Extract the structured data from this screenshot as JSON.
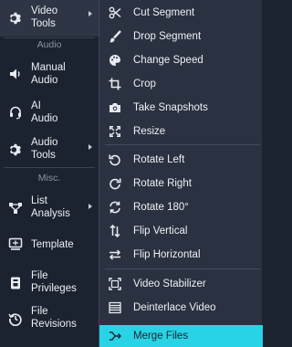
{
  "sidebar": {
    "video_tools": "Video\nTools",
    "audio_section": "Audio",
    "manual_audio": "Manual\nAudio",
    "ai_audio": "AI\nAudio",
    "audio_tools": "Audio\nTools",
    "misc_section": "Misc.",
    "list_analysis": "List\nAnalysis",
    "template": "Template",
    "file_privileges": "File\nPrivileges",
    "file_revisions": "File\nRevisions"
  },
  "menu": {
    "items": [
      {
        "label": "Cut Segment",
        "icon": "scissors-icon"
      },
      {
        "label": "Drop Segment",
        "icon": "brush-icon"
      },
      {
        "label": "Change Speed",
        "icon": "palette-icon"
      },
      {
        "label": "Crop",
        "icon": "crop-icon"
      },
      {
        "label": "Take Snapshots",
        "icon": "camera-icon"
      },
      {
        "label": "Resize",
        "icon": "resize-icon"
      },
      {
        "label": "Rotate Left",
        "icon": "rotate-left-icon"
      },
      {
        "label": "Rotate Right",
        "icon": "rotate-right-icon"
      },
      {
        "label": "Rotate 180°",
        "icon": "rotate-180-icon"
      },
      {
        "label": "Flip Vertical",
        "icon": "flip-vertical-icon"
      },
      {
        "label": "Flip Horizontal",
        "icon": "flip-horizontal-icon"
      },
      {
        "label": "Video Stabilizer",
        "icon": "stabilizer-icon"
      },
      {
        "label": "Deinterlace Video",
        "icon": "deinterlace-icon"
      },
      {
        "label": "Merge Files",
        "icon": "merge-icon"
      }
    ]
  },
  "colors": {
    "sidebar_bg": "#1b2230",
    "menu_bg": "#2a3241",
    "highlight": "#29d3e6"
  }
}
